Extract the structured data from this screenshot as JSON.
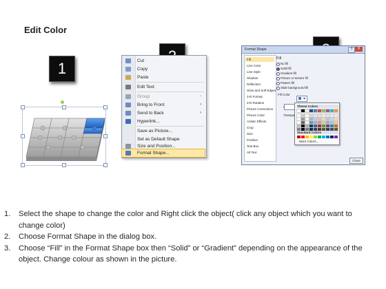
{
  "slide": {
    "title": "Edit Color"
  },
  "badges": [
    "1",
    "2",
    "3"
  ],
  "context_menu": {
    "items": [
      {
        "label": "Cut",
        "icon": "scissors-icon",
        "color": "#6e8fc9"
      },
      {
        "label": "Copy",
        "icon": "copy-icon",
        "color": "#7a9bd6"
      },
      {
        "label": "Paste",
        "icon": "paste-icon",
        "color": "#c9a85a"
      },
      {
        "label": "Edit Text",
        "icon": "edit-text-icon",
        "color": "#7a7a7a"
      },
      {
        "label": "Group",
        "icon": "group-icon",
        "color": "#9aa4b8",
        "disabled": true,
        "submenu": true
      },
      {
        "label": "Bring to Front",
        "icon": "bring-front-icon",
        "color": "#6b8cc4",
        "submenu": true
      },
      {
        "label": "Send to Back",
        "icon": "send-back-icon",
        "color": "#6b8cc4",
        "submenu": true
      },
      {
        "label": "Hyperlink...",
        "icon": "hyperlink-icon",
        "color": "#3e6db3"
      },
      {
        "label": "Save as Picture...",
        "icon": "none",
        "color": ""
      },
      {
        "label": "Set as Default Shape",
        "icon": "none",
        "color": ""
      },
      {
        "label": "Size and Position...",
        "icon": "size-icon",
        "color": "#8a95a8"
      },
      {
        "label": "Format Shape...",
        "icon": "format-shape-icon",
        "color": "#4f79c2",
        "highlighted": true
      }
    ]
  },
  "dialog": {
    "title": "Format Shape",
    "help_label": "?",
    "close_label": "X",
    "categories": [
      "Fill",
      "Line Color",
      "Line Style",
      "Shadow",
      "Reflection",
      "Glow and Soft Edges",
      "3-D Format",
      "3-D Rotation",
      "Picture Corrections",
      "Picture Color",
      "Artistic Effects",
      "Crop",
      "Size",
      "Position",
      "Text Box",
      "Alt Text"
    ],
    "section_title": "Fill",
    "fill_options": [
      "No fill",
      "Solid fill",
      "Gradient fill",
      "Picture or texture fill",
      "Pattern fill",
      "Slide background fill"
    ],
    "selected_fill": "Solid fill",
    "fill_color_label": "Fill Color",
    "color_label": "Color:",
    "transparency_label": "Transparency:",
    "theme_colors_label": "Theme Colors",
    "standard_colors_label": "Standard Colors",
    "more_colors_label": "More Colors...",
    "close_button": "Close",
    "theme_colors": [
      "#ffffff",
      "#000000",
      "#eeece1",
      "#1f497d",
      "#4f81bd",
      "#c0504d",
      "#9bbb59",
      "#8064a2",
      "#4bacc6",
      "#f79646"
    ],
    "standard_colors": [
      "#c00000",
      "#ff0000",
      "#ffc000",
      "#ffff00",
      "#92d050",
      "#00b050",
      "#00b0f0",
      "#0070c0",
      "#002060",
      "#7030a0"
    ]
  },
  "instructions": [
    {
      "number": "1.",
      "text": "Select the shape to change the color and Right click the object( click any object which you want to change color)"
    },
    {
      "number": "2.",
      "text": "Choose Format Shape in the dialog box."
    },
    {
      "number": "3.",
      "text": "Choose “Fill” in the Format Shape box then “Solid” or “Gradient” depending on the appearance of the object. Change colour as shown in the picture."
    }
  ],
  "colors": {
    "puzzle_grey": "#bdbdbd",
    "puzzle_highlight": "#2f78d6",
    "menu_highlight": "#fde8a5"
  }
}
